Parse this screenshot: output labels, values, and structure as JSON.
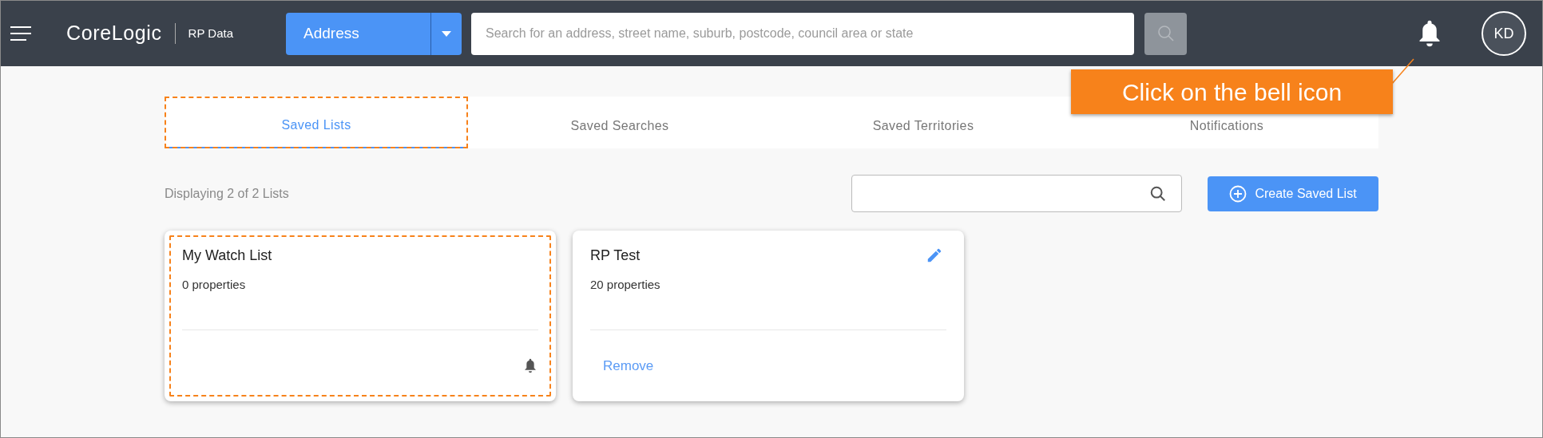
{
  "header": {
    "logo": "CoreLogic",
    "product": "RP Data",
    "search_type": "Address",
    "search": {
      "placeholder": "Search for an address, street name, suburb, postcode, council area or state"
    },
    "avatar": "KD"
  },
  "callout": "Click on the bell icon",
  "tabs": [
    {
      "label": "Saved Lists",
      "selected": true,
      "highlighted": true
    },
    {
      "label": "Saved Searches",
      "selected": false,
      "highlighted": false
    },
    {
      "label": "Saved Territories",
      "selected": false,
      "highlighted": false
    },
    {
      "label": "Notifications",
      "selected": false,
      "highlighted": false
    }
  ],
  "summary": "Displaying 2 of 2 Lists",
  "create_button": "Create Saved List",
  "lists": [
    {
      "name": "My Watch List",
      "count": "0 properties",
      "kind": "watch",
      "highlighted": true
    },
    {
      "name": "RP Test",
      "count": "20 properties",
      "kind": "editable",
      "action": "Remove",
      "highlighted": false
    }
  ]
}
